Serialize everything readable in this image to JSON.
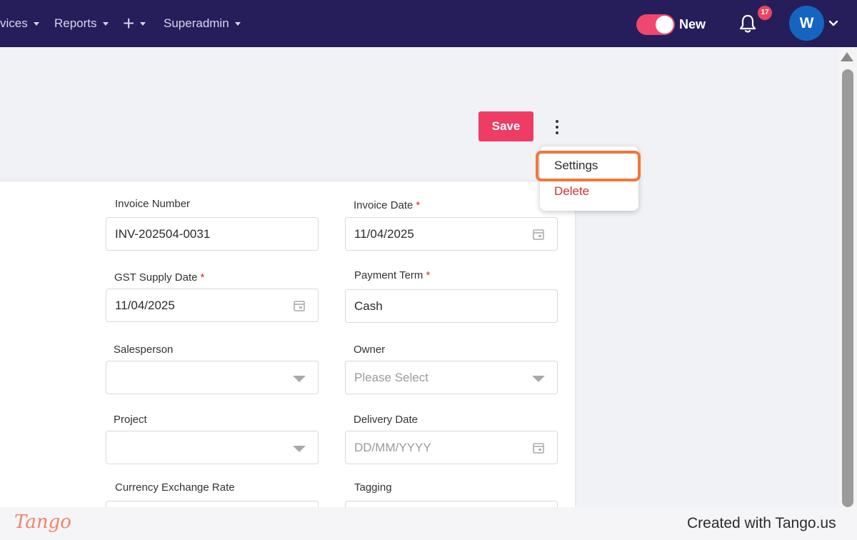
{
  "nav": {
    "items": [
      {
        "label": "vices"
      },
      {
        "label": "Reports"
      },
      {
        "label": "+"
      },
      {
        "label": "Superadmin"
      }
    ],
    "toggle_label": "New",
    "toggle_on": true,
    "notification_count": "17",
    "avatar_initial": "W"
  },
  "toolbar": {
    "save_label": "Save"
  },
  "menu": {
    "settings_label": "Settings",
    "delete_label": "Delete"
  },
  "form": {
    "invoice_number": {
      "label": "Invoice Number",
      "value": "INV-202504-0031"
    },
    "invoice_date": {
      "label": "Invoice Date",
      "required": "*",
      "value": "11/04/2025"
    },
    "gst_supply_date": {
      "label": "GST Supply Date",
      "required": "*",
      "value": "11/04/2025"
    },
    "payment_term": {
      "label": "Payment Term",
      "required": "*",
      "value": "Cash"
    },
    "salesperson": {
      "label": "Salesperson",
      "value": ""
    },
    "owner": {
      "label": "Owner",
      "placeholder": "Please Select"
    },
    "project": {
      "label": "Project",
      "value": ""
    },
    "delivery_date": {
      "label": "Delivery Date",
      "placeholder": "DD/MM/YYYY"
    },
    "currency_exchange_rate": {
      "label": "Currency Exchange Rate"
    },
    "tagging": {
      "label": "Tagging"
    }
  },
  "footer": {
    "logo_text": "Tango",
    "created_text": "Created with Tango.us"
  },
  "colors": {
    "nav_bg": "#261e5a",
    "accent": "#ee3c65",
    "highlight": "#f0773a",
    "delete": "#d32f2f",
    "avatar": "#1565c0"
  }
}
